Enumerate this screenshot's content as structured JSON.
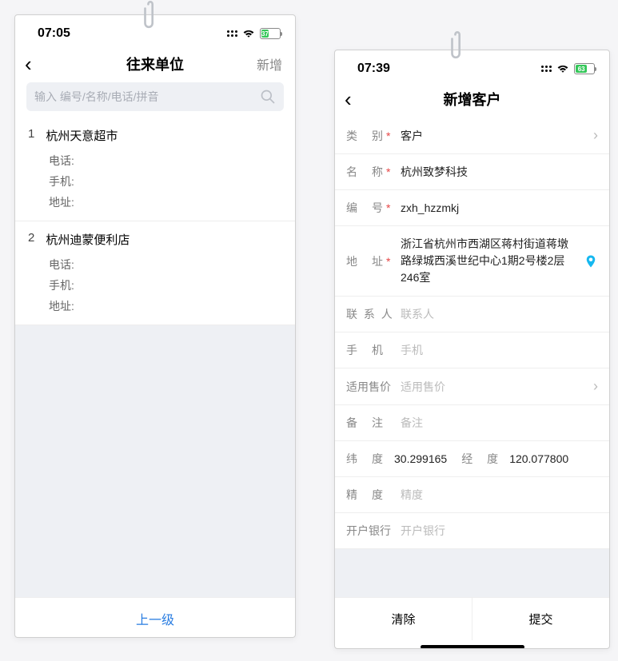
{
  "left": {
    "status": {
      "time": "07:05",
      "battery_pct": "37"
    },
    "nav": {
      "title": "往来单位",
      "action": "新增"
    },
    "search": {
      "placeholder": "输入 编号/名称/电话/拼音"
    },
    "items": [
      {
        "idx": "1",
        "name": "杭州天意超市",
        "phone_label": "电话:",
        "mobile_label": "手机:",
        "addr_label": "地址:"
      },
      {
        "idx": "2",
        "name": "杭州迪蒙便利店",
        "phone_label": "电话:",
        "mobile_label": "手机:",
        "addr_label": "地址:"
      }
    ],
    "footer": {
      "prev": "上一级"
    }
  },
  "right": {
    "status": {
      "time": "07:39",
      "battery_pct": "63"
    },
    "nav": {
      "title": "新增客户"
    },
    "fields": {
      "category_label": "类　别",
      "category_value": "客户",
      "name_label": "名　称",
      "name_value": "杭州致梦科技",
      "code_label": "编　号",
      "code_value": "zxh_hzzmkj",
      "addr_label": "地　址",
      "addr_value": "浙江省杭州市西湖区蒋村街道蒋墩路绿城西溪世纪中心1期2号楼2层246室",
      "contact_label": "联 系 人",
      "contact_placeholder": "联系人",
      "mobile_label": "手　机",
      "mobile_placeholder": "手机",
      "price_label": "适用售价",
      "price_placeholder": "适用售价",
      "remark_label": "备　注",
      "remark_placeholder": "备注",
      "lat_label": "纬　度",
      "lat_value": "30.299165",
      "lon_label": "经　度",
      "lon_value": "120.077800",
      "precision_label": "精　度",
      "precision_placeholder": "精度",
      "bank_label": "开户银行",
      "bank_placeholder": "开户银行"
    },
    "footer": {
      "clear": "清除",
      "submit": "提交"
    }
  }
}
